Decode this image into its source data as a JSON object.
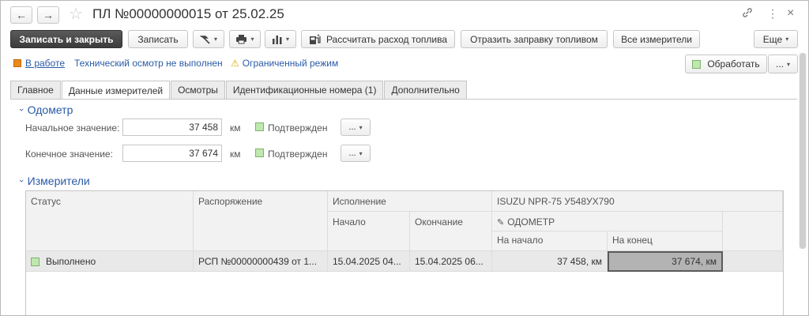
{
  "window": {
    "title": "ПЛ №00000000015 от 25.02.25",
    "back_glyph": "←",
    "forward_glyph": "→",
    "star_glyph": "☆",
    "link_glyph": "🔗",
    "more_glyph": "⋮",
    "close_glyph": "×"
  },
  "toolbar": {
    "save_close": "Записать и закрыть",
    "save": "Записать",
    "calc_fuel": "Рассчитать расход топлива",
    "reflect_fuel": "Отразить заправку топливом",
    "all_meters": "Все измерители",
    "more": "Еще",
    "process": "Обработать",
    "dots": "...",
    "caret": "▾"
  },
  "status": {
    "state": "В работе",
    "inspection": "Технический осмотр не выполнен",
    "mode": "Ограниченный режим"
  },
  "tabs": [
    {
      "label": "Главное"
    },
    {
      "label": "Данные измерителей"
    },
    {
      "label": "Осмотры"
    },
    {
      "label": "Идентификационные номера (1)"
    },
    {
      "label": "Дополнительно"
    }
  ],
  "odometer": {
    "heading": "Одометр",
    "start_label": "Начальное значение:",
    "start_value": "37 458",
    "end_label": "Конечное значение:",
    "end_value": "37 674",
    "unit": "км",
    "confirmed": "Подтвержден",
    "dots": "..."
  },
  "meters": {
    "heading": "Измерители",
    "headers": {
      "status": "Статус",
      "order": "Распоряжение",
      "execution": "Исполнение",
      "start": "Начало",
      "end": "Окончание",
      "vehicle": "ISUZU NPR-75 У548УХ790",
      "odometer": "ОДОМЕТР",
      "at_start": "На начало",
      "at_end": "На конец"
    },
    "rows": [
      {
        "status": "Выполнено",
        "order": "РСП №00000000439 от 1...",
        "start": "15.04.2025 04...",
        "end": "15.04.2025 06...",
        "at_start": "37 458, км",
        "at_end": "37 674, км"
      }
    ]
  },
  "colors": {
    "accent": "#2a5aa6",
    "status_orange": "#e98a1b",
    "confirmed_green": "#bfe8b0"
  }
}
